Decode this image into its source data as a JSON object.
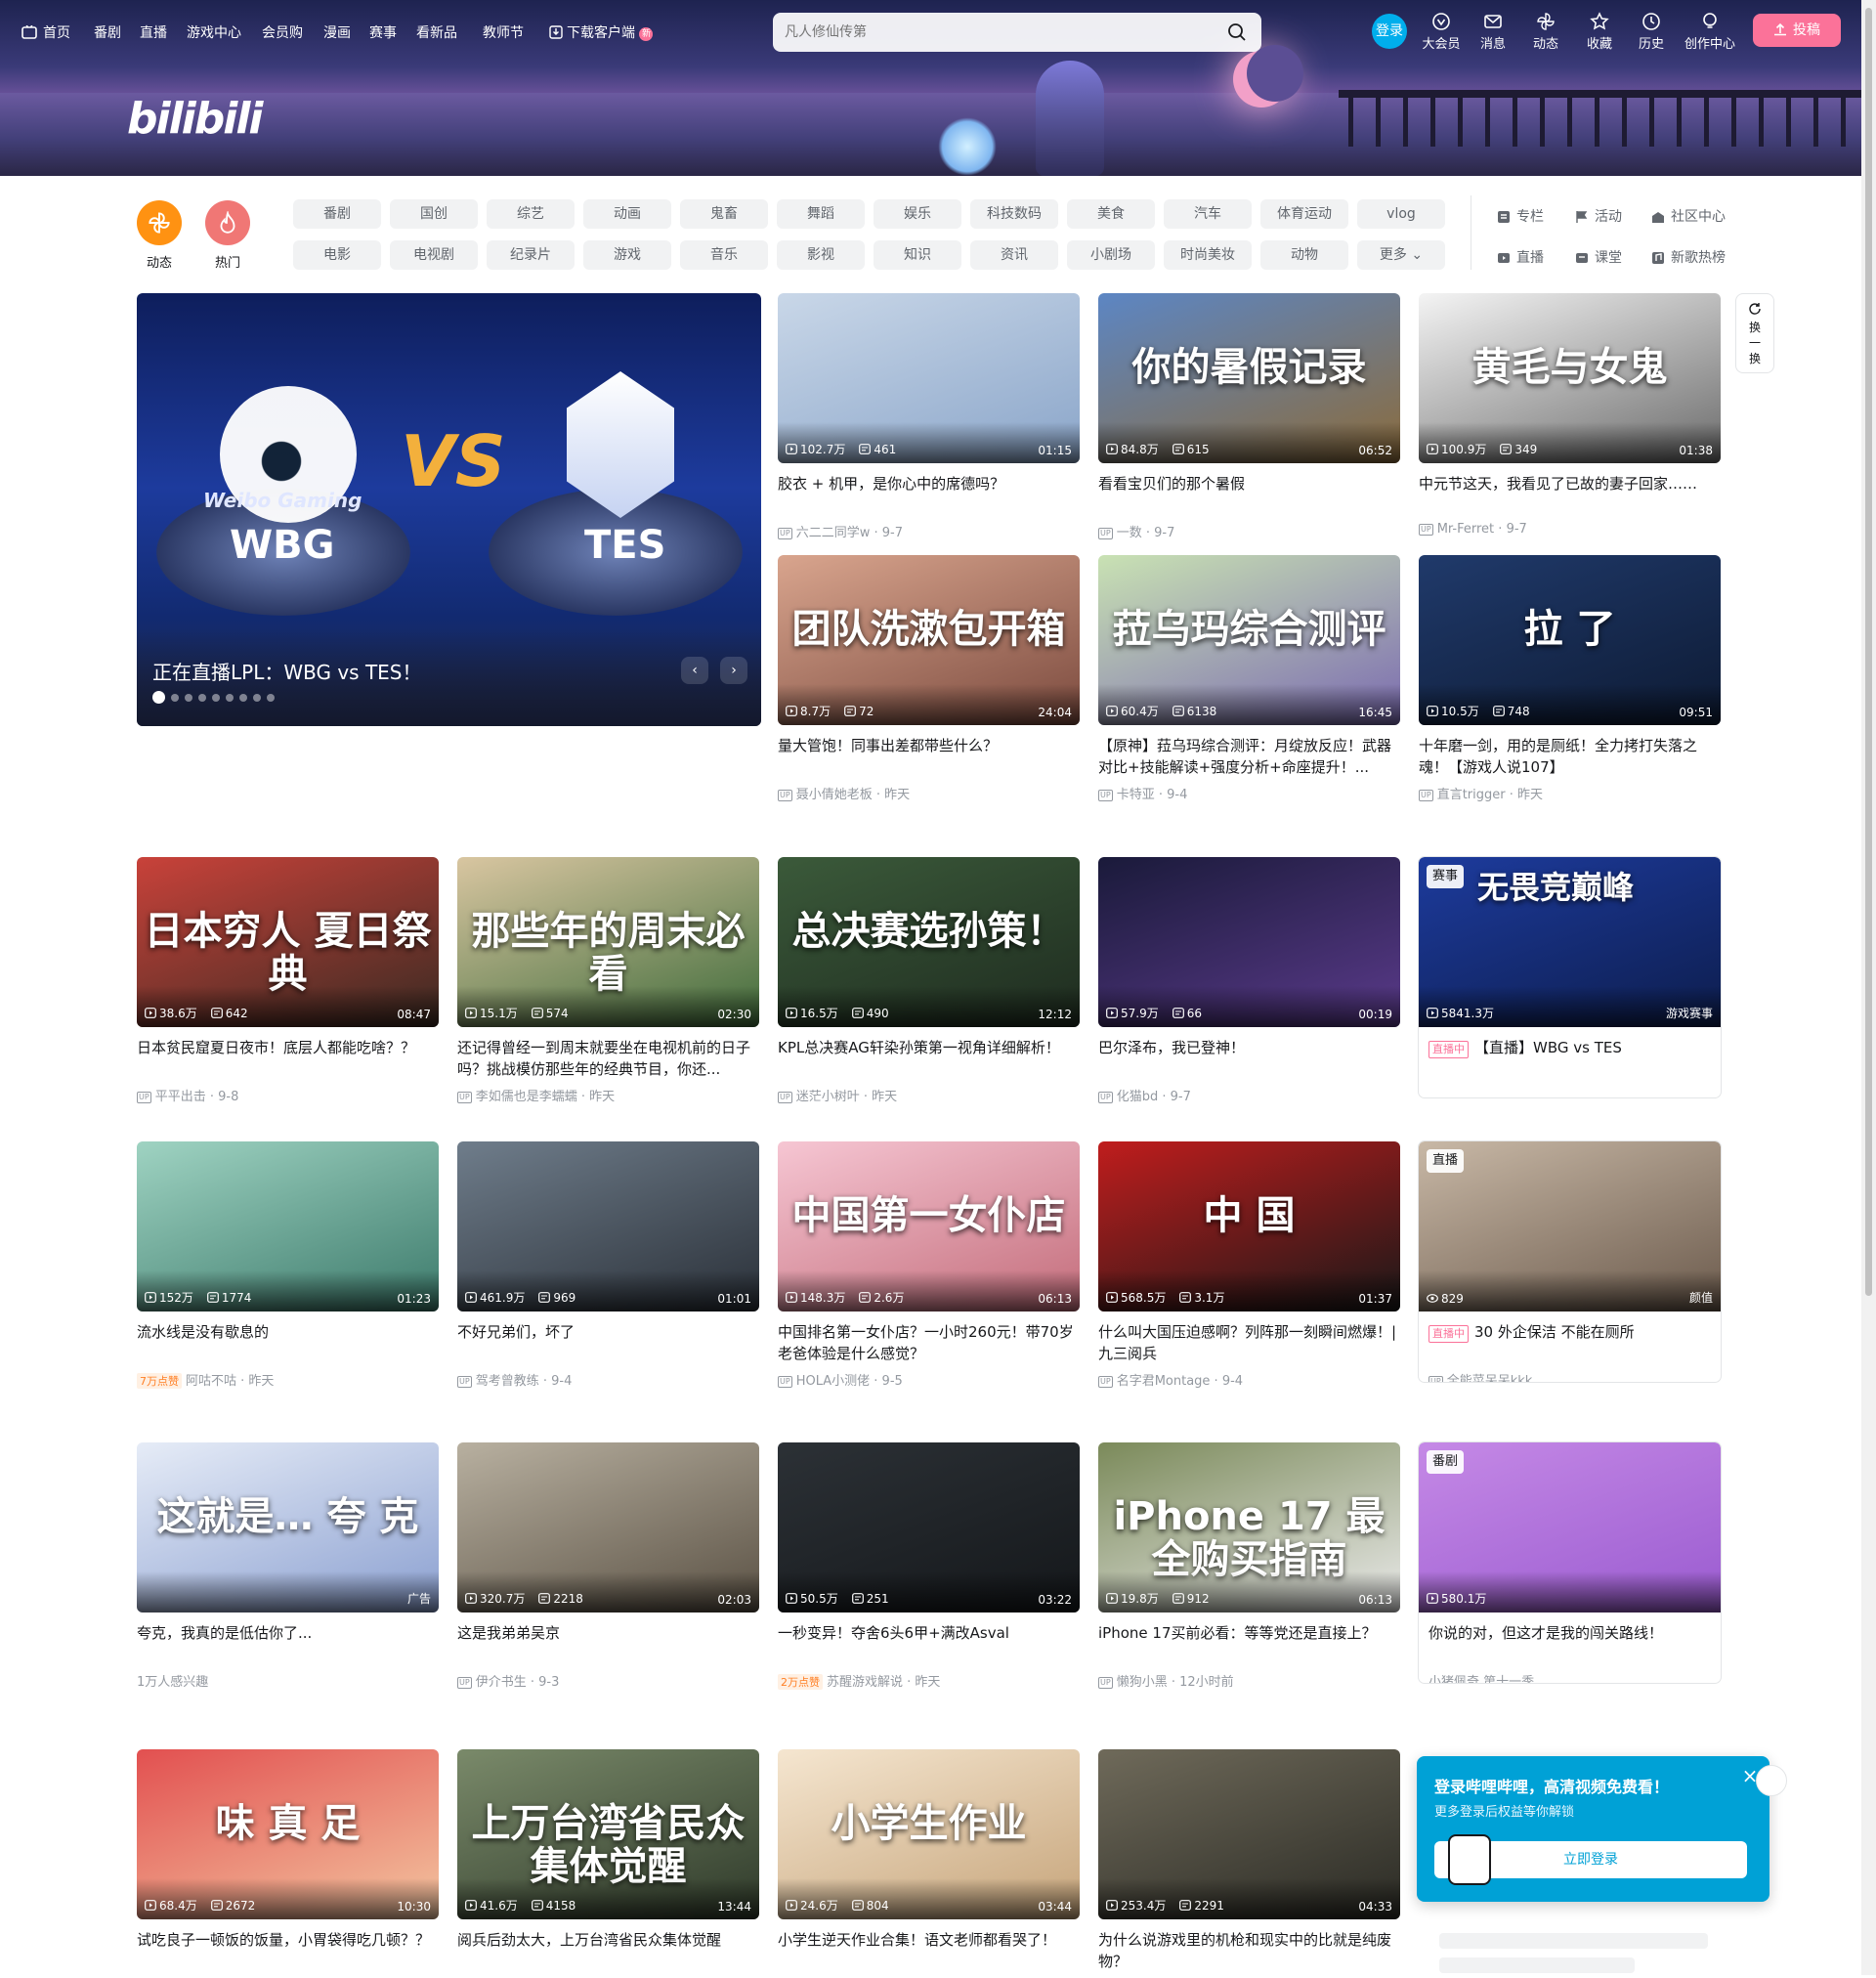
{
  "nav": {
    "left": [
      "首页",
      "番剧",
      "直播",
      "游戏中心",
      "会员购",
      "漫画",
      "赛事",
      "看新品",
      "教师节",
      "下载客户端"
    ],
    "new_badge": "新",
    "search_placeholder": "凡人修仙传第",
    "login": "登录",
    "right": [
      "大会员",
      "消息",
      "动态",
      "收藏",
      "历史",
      "创作中心"
    ],
    "upload": "投稿"
  },
  "logo": "bilibili",
  "quick": {
    "dynamic": "动态",
    "hot": "热门"
  },
  "channels": [
    [
      "番剧",
      "国创",
      "综艺",
      "动画",
      "鬼畜",
      "舞蹈",
      "娱乐",
      "科技数码",
      "美食",
      "汽车",
      "体育运动",
      "vlog"
    ],
    [
      "电影",
      "电视剧",
      "纪录片",
      "游戏",
      "音乐",
      "影视",
      "知识",
      "资讯",
      "小剧场",
      "时尚美妆",
      "动物",
      "更多"
    ]
  ],
  "side_links": [
    [
      "专栏",
      "活动",
      "社区中心"
    ],
    [
      "直播",
      "课堂",
      "新歌热榜"
    ]
  ],
  "hero": {
    "title": "正在直播LPL：WBG vs TES！",
    "left_team": "WBG",
    "right_team": "TES",
    "vs": "VS",
    "left_brand": "Weibo Gaming",
    "slides": 9,
    "active_slide": 0
  },
  "refresh_label": "换一换",
  "cards": [
    {
      "title": "胶衣 + 机甲，是你心中的席德吗？",
      "plays": "102.7万",
      "danmaku": "461",
      "duration": "01:15",
      "author": "六二二同学w",
      "date": "9-7",
      "overlay": ""
    },
    {
      "title": "看看宝贝们的那个暑假",
      "plays": "84.8万",
      "danmaku": "615",
      "duration": "06:52",
      "author": "一数",
      "date": "9-7",
      "overlay": "你的暑假记录"
    },
    {
      "title": "中元节这天，我看见了已故的妻子回家……",
      "plays": "100.9万",
      "danmaku": "349",
      "duration": "01:38",
      "author": "Mr-Ferret",
      "date": "9-7",
      "overlay": "黄毛与女鬼"
    },
    {
      "title": "量大管饱！同事出差都带些什么？",
      "plays": "8.7万",
      "danmaku": "72",
      "duration": "24:04",
      "author": "聂小倩她老板",
      "date": "昨天",
      "overlay": "团队洗漱包开箱"
    },
    {
      "title": "【原神】菈乌玛综合测评：月绽放反应！武器对比+技能解读+强度分析+命座提升！...",
      "plays": "60.4万",
      "danmaku": "6138",
      "duration": "16:45",
      "author": "卡特亚",
      "date": "9-4",
      "overlay": "菈乌玛综合测评"
    },
    {
      "title": "十年磨一剑，用的是厕纸！全力拷打失落之魂！【游戏人说107】",
      "plays": "10.5万",
      "danmaku": "748",
      "duration": "09:51",
      "author": "直言trigger",
      "date": "昨天",
      "overlay": "拉 了"
    },
    {
      "title": "日本贫民窟夏日夜市！底层人都能吃啥？？",
      "plays": "38.6万",
      "danmaku": "642",
      "duration": "08:47",
      "author": "平平出击",
      "date": "9-8",
      "overlay": "日本穷人 夏日祭典"
    },
    {
      "title": "还记得曾经一到周末就要坐在电视机前的日子吗？挑战模仿那些年的经典节目，你还...",
      "plays": "15.1万",
      "danmaku": "574",
      "duration": "02:30",
      "author": "李如儒也是李蠕蠕",
      "date": "昨天",
      "overlay": "那些年的周末必看"
    },
    {
      "title": "KPL总决赛AG轩染孙策第一视角详细解析！",
      "plays": "16.5万",
      "danmaku": "490",
      "duration": "12:12",
      "author": "迷茫小树叶",
      "date": "昨天",
      "overlay": "总决赛选孙策！"
    },
    {
      "title": "巴尔泽布，我已登神！",
      "plays": "57.9万",
      "danmaku": "66",
      "duration": "00:19",
      "author": "化猫bd",
      "date": "9-7",
      "overlay": ""
    },
    {
      "title": "流水线是没有歇息的",
      "plays": "152万",
      "danmaku": "1774",
      "duration": "01:23",
      "author": "阿咕不咕",
      "date": "昨天",
      "overlay": "",
      "tag": "7万点赞"
    },
    {
      "title": "不好兄弟们，坏了",
      "plays": "461.9万",
      "danmaku": "969",
      "duration": "01:01",
      "author": "驾考曾教练",
      "date": "9-4",
      "overlay": ""
    },
    {
      "title": "中国排名第一女仆店？一小时260元！带70岁老爸体验是什么感觉？",
      "plays": "148.3万",
      "danmaku": "2.6万",
      "duration": "06:13",
      "author": "HOLA小测佬",
      "date": "9-5",
      "overlay": "中国第一女仆店"
    },
    {
      "title": "什么叫大国压迫感啊？列阵那一刻瞬间燃爆！| 九三阅兵",
      "plays": "568.5万",
      "danmaku": "3.1万",
      "duration": "01:37",
      "author": "名字君Montage",
      "date": "9-4",
      "overlay": "中 国"
    },
    {
      "title": "夸克，我真的是低估你了...",
      "plays": "",
      "danmaku": "",
      "duration": "",
      "author": "",
      "date": "",
      "overlay": "这就是… 夸 克",
      "ad": "广告",
      "ad_meta": "1万人感兴趣"
    },
    {
      "title": "这是我弟弟吴京",
      "plays": "320.7万",
      "danmaku": "2218",
      "duration": "02:03",
      "author": "伊介书生",
      "date": "9-3",
      "overlay": ""
    },
    {
      "title": "一秒变异！夺舍6头6甲+满改Asval",
      "plays": "50.5万",
      "danmaku": "251",
      "duration": "03:22",
      "author": "苏醒游戏解说",
      "date": "昨天",
      "overlay": "",
      "tag": "2万点赞"
    },
    {
      "title": "iPhone 17买前必看：等等党还是直接上？",
      "plays": "19.8万",
      "danmaku": "912",
      "duration": "06:13",
      "author": "懒狗小黑",
      "date": "12小时前",
      "overlay": "iPhone 17 最全购买指南"
    },
    {
      "title": "试吃良子一顿饭的饭量，小胃袋得吃几顿？？",
      "plays": "68.4万",
      "danmaku": "2672",
      "duration": "10:30",
      "author": "",
      "date": "",
      "overlay": "味 真 足"
    },
    {
      "title": "阅兵后劲太大，上万台湾省民众集体觉醒",
      "plays": "41.6万",
      "danmaku": "4158",
      "duration": "13:44",
      "author": "",
      "date": "",
      "overlay": "上万台湾省民众 集体觉醒"
    },
    {
      "title": "小学生逆天作业合集！语文老师都看哭了！",
      "plays": "24.6万",
      "danmaku": "804",
      "duration": "03:44",
      "author": "",
      "date": "",
      "overlay": "小学生作业"
    },
    {
      "title": "为什么说游戏里的机枪和现实中的比就是纯废物？",
      "plays": "253.4万",
      "danmaku": "2291",
      "duration": "04:33",
      "author": "",
      "date": "",
      "overlay": ""
    }
  ],
  "specials": [
    {
      "kind": "live-event",
      "pill": "赛事",
      "plays": "5841.3万",
      "category": "游戏赛事",
      "badge": "直播中",
      "title": "【直播】WBG vs TES",
      "overlay": "无畏竞巅峰",
      "author": ""
    },
    {
      "kind": "live",
      "pill": "直播",
      "plays": "829",
      "category": "颜值",
      "badge": "直播中",
      "title": "30 外企保洁 不能在厕所",
      "author": "全能菜呆呆kkk"
    },
    {
      "kind": "bangumi",
      "pill": "番剧",
      "plays": "580.1万",
      "title": "你说的对，但这才是我的闯关路线！",
      "author": "小猪佩奇 第十一季"
    }
  ],
  "login_popup": {
    "title": "登录哔哩哔哩，高清视频免费看！",
    "subtitle": "更多登录后权益等你解锁",
    "button": "立即登录"
  },
  "colors": {
    "accent": "#fb7299",
    "blue": "#00aeec",
    "login_bg": "#00a1d6",
    "quick_dynamic": "#ff9212",
    "quick_hot": "#f07775"
  }
}
